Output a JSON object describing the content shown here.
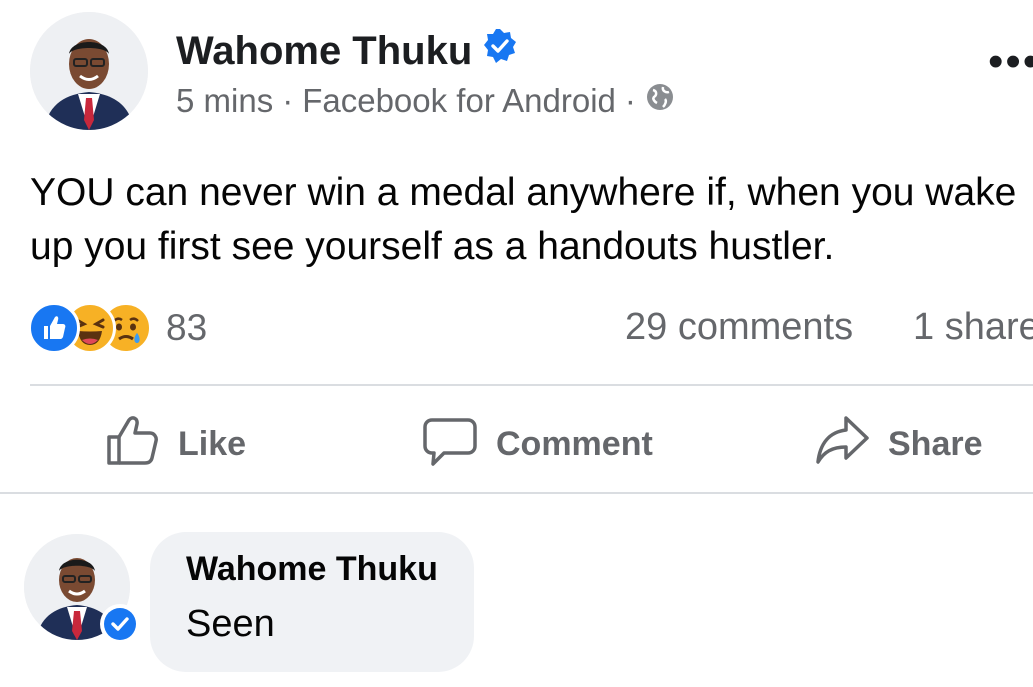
{
  "post": {
    "author": "Wahome Thuku",
    "time": "5 mins",
    "sep1": "·",
    "source": "Facebook for Android",
    "sep2": "·",
    "text": "YOU can never win a medal anywhere if, when you wake up you first see yourself as a handouts hustler.",
    "more_label": "•••"
  },
  "stats": {
    "reaction_count": "83",
    "comments": "29 comments",
    "shares": "1 share"
  },
  "actions": {
    "like": "Like",
    "comment": "Comment",
    "share": "Share"
  },
  "comment": {
    "author": "Wahome Thuku",
    "text": "Seen"
  },
  "colors": {
    "verified": "#1877f2",
    "like_blue": "#1877f2",
    "haha_yellow": "#f7b125",
    "muted_text": "#65676b",
    "bubble_bg": "#f0f2f5"
  },
  "icons": [
    "verified-badge-icon",
    "globe-icon",
    "like-reaction-icon",
    "haha-reaction-icon",
    "sad-reaction-icon",
    "thumbs-up-icon",
    "comment-icon",
    "share-arrow-icon"
  ]
}
